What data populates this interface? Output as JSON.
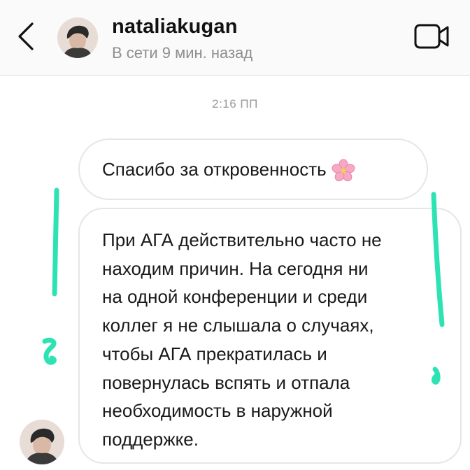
{
  "header": {
    "username": "nataliakugan",
    "status": "В сети 9 мин. назад",
    "back_icon": "chevron-left-icon",
    "video_icon": "video-camera-icon"
  },
  "chat": {
    "timestamp": "2:16 ПП",
    "messages": [
      {
        "text": "Спасибо за откровенность",
        "emoji": "cherry-blossom-icon"
      },
      {
        "lines": [
          "При АГА действительно часто не",
          "находим причин. На сегодня ни",
          "на одной конференции и среди",
          "коллег я не слышала о случаях,",
          "чтобы АГА прекратилась и",
          "повернулась вспять и отпала",
          "необходимость в наружной",
          "поддержке."
        ]
      }
    ]
  },
  "colors": {
    "header_bg": "#fafafa",
    "bubble_border": "#e6e6e6",
    "muted_text": "#8e8e8e",
    "annotation_marker": "#2de3b4"
  }
}
